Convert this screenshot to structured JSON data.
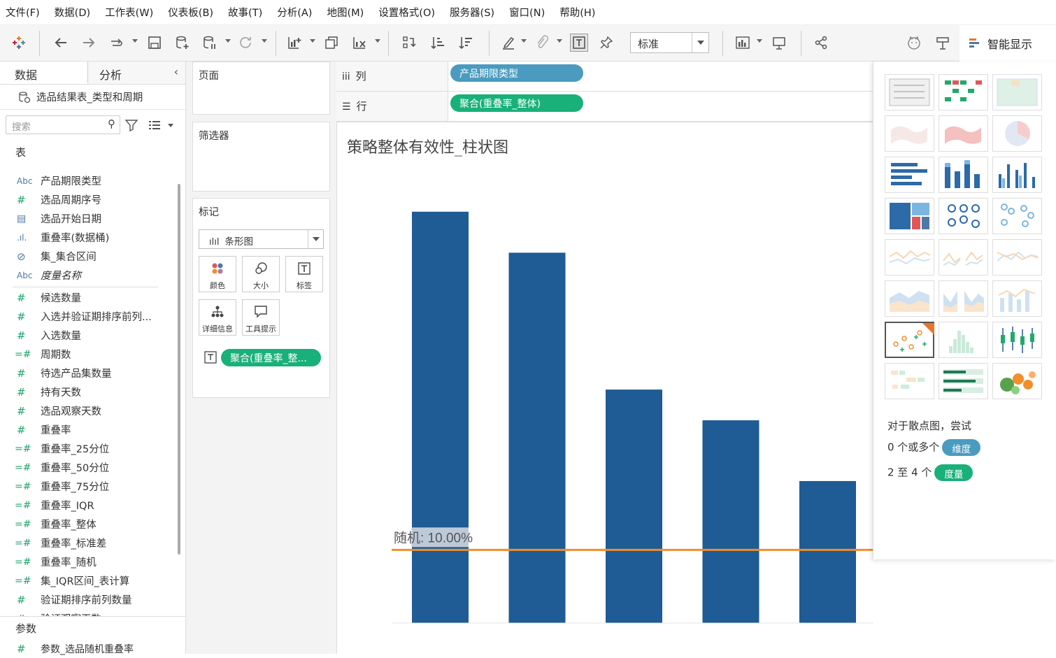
{
  "menu": [
    "文件(F)",
    "数据(D)",
    "工作表(W)",
    "仪表板(B)",
    "故事(T)",
    "分析(A)",
    "地图(M)",
    "设置格式(O)",
    "服务器(S)",
    "窗口(N)",
    "帮助(H)"
  ],
  "toolbar": {
    "standard_select": "标准",
    "show_me": "智能显示",
    "icons": [
      "tableau-logo-icon",
      "back-icon",
      "forward-icon",
      "replay-icon",
      "save-icon",
      "new-datasource-icon",
      "pause-datasource-icon",
      "refresh-icon",
      "new-worksheet-icon",
      "duplicate-icon",
      "clear-icon",
      "swap-icon",
      "sort-asc-icon",
      "sort-desc-icon",
      "highlight-icon",
      "group-icon",
      "label-icon",
      "pin-icon",
      "show-cards-icon",
      "presentation-icon",
      "share-icon",
      "cat-icon",
      "ask-data-icon"
    ]
  },
  "data_pane": {
    "tab_data": "数据",
    "tab_analysis": "分析",
    "datasource": "选品结果表_类型和周期",
    "search_placeholder": "搜索",
    "tables_header": "表",
    "fields": [
      {
        "type": "Abc",
        "label": "产品期限类型",
        "kind": "dim"
      },
      {
        "type": "#",
        "label": "选品周期序号",
        "kind": "dimnum"
      },
      {
        "type": "cal",
        "label": "选品开始日期",
        "kind": "dim"
      },
      {
        "type": "bin",
        "label": "重叠率(数据桶)",
        "kind": "dim"
      },
      {
        "type": "set",
        "label": "集_集合区间",
        "kind": "dim"
      },
      {
        "type": "Abc",
        "label": "度量名称",
        "kind": "dim",
        "italic": true
      },
      {
        "type": "sep"
      },
      {
        "type": "#",
        "label": "候选数量",
        "kind": "meas"
      },
      {
        "type": "#",
        "label": "入选并验证期排序前列...",
        "kind": "meas"
      },
      {
        "type": "#",
        "label": "入选数量",
        "kind": "meas"
      },
      {
        "type": "=#",
        "label": "周期数",
        "kind": "calc"
      },
      {
        "type": "#",
        "label": "待选产品集数量",
        "kind": "meas"
      },
      {
        "type": "#",
        "label": "持有天数",
        "kind": "meas"
      },
      {
        "type": "#",
        "label": "选品观察天数",
        "kind": "meas"
      },
      {
        "type": "#",
        "label": "重叠率",
        "kind": "meas"
      },
      {
        "type": "=#",
        "label": "重叠率_25分位",
        "kind": "calc"
      },
      {
        "type": "=#",
        "label": "重叠率_50分位",
        "kind": "calc"
      },
      {
        "type": "=#",
        "label": "重叠率_75分位",
        "kind": "calc"
      },
      {
        "type": "=#",
        "label": "重叠率_IQR",
        "kind": "calc"
      },
      {
        "type": "=#",
        "label": "重叠率_整体",
        "kind": "calc"
      },
      {
        "type": "=#",
        "label": "重叠率_标准差",
        "kind": "calc"
      },
      {
        "type": "=#",
        "label": "重叠率_随机",
        "kind": "calc"
      },
      {
        "type": "=#",
        "label": "集_IQR区间_表计算",
        "kind": "calc"
      },
      {
        "type": "#",
        "label": "验证期排序前列数量",
        "kind": "meas"
      },
      {
        "type": "#",
        "label": "验证观察天数",
        "kind": "meas"
      }
    ],
    "params_header": "参数",
    "param": "参数_选品随机重叠率"
  },
  "cards": {
    "pages": "页面",
    "filters": "筛选器",
    "marks": "标记",
    "mark_type": "条形图",
    "buttons": [
      "颜色",
      "大小",
      "标签",
      "详细信息",
      "工具提示"
    ],
    "label_pill": "聚合(重叠率_整..."
  },
  "shelves": {
    "columns_label": "列",
    "columns_pill": "产品期限类型",
    "rows_label": "行",
    "rows_pill": "聚合(重叠率_整体)"
  },
  "colors": {
    "bar": "#1f5b94",
    "refline": "#f28e2b",
    "pill_green": "#19b07a",
    "pill_blue": "#4a9bbf"
  },
  "chart_data": {
    "type": "bar",
    "title": "策略整体有效性_柱状图",
    "categories": [
      "",
      "",
      "",
      "",
      ""
    ],
    "values": [
      56.2,
      50.6,
      31.9,
      27.7,
      19.4
    ],
    "value_labels": [
      "",
      "",
      "",
      "",
      ""
    ],
    "ylim": [
      0,
      60
    ],
    "ytick_labels": [
      "",
      "",
      "",
      "",
      "",
      "",
      ""
    ],
    "reference_line": {
      "value": 10.0,
      "label": "随机: 10.00%"
    },
    "grid": false
  },
  "show_me": {
    "hint_line1": "对于散点图，尝试",
    "hint_line2_pre": "0 个或多个",
    "hint_line2_pill": "维度",
    "hint_line3_pre": "2 至 4 个",
    "hint_line3_pill": "度量",
    "tiles": [
      "text-table",
      "heat-map",
      "highlight-table",
      "symbol-map",
      "filled-map",
      "pie",
      "horizontal-bars",
      "stacked-bars",
      "side-by-side-bars",
      "treemap",
      "circle-views",
      "side-by-side-circles",
      "line-continuous",
      "line-discrete",
      "dual-lines",
      "area-continuous",
      "area-discrete",
      "dual-combination",
      "scatter-plot",
      "histogram",
      "box-whisker",
      "gantt",
      "bullet",
      "packed-bubbles"
    ]
  }
}
